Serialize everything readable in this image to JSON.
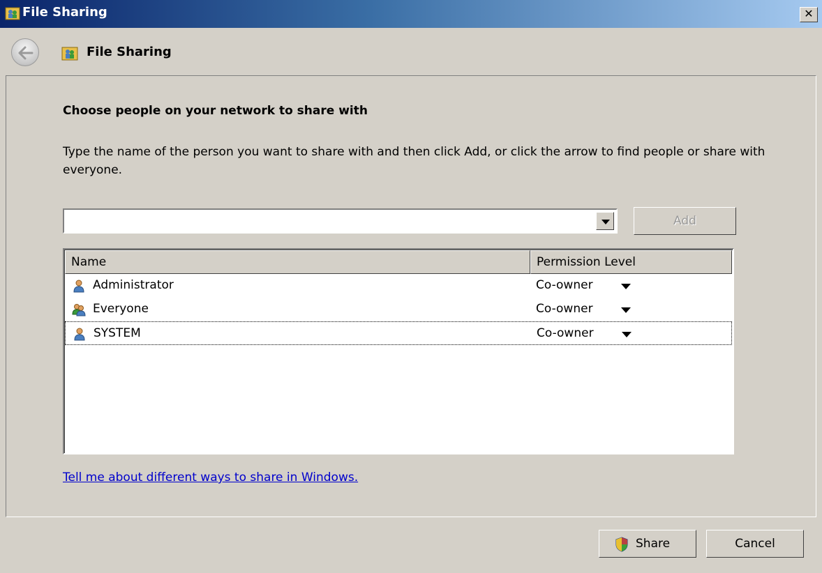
{
  "window": {
    "title": "File Sharing",
    "close_glyph": "✕"
  },
  "nav": {
    "title": "File Sharing",
    "back_icon": "back-arrow-icon"
  },
  "content": {
    "heading": "Choose people on your network to share with",
    "instructions": "Type the name of the person you want to share with and then click Add, or click the arrow to find people or share with everyone.",
    "combo_value": "",
    "add_label": "Add",
    "help_link": "Tell me about different ways to share in Windows."
  },
  "list": {
    "columns": {
      "name": "Name",
      "permission": "Permission Level"
    },
    "rows": [
      {
        "name": "Administrator",
        "permission": "Co-owner",
        "icon": "single-user-icon"
      },
      {
        "name": "Everyone",
        "permission": "Co-owner",
        "icon": "group-users-icon"
      },
      {
        "name": "SYSTEM",
        "permission": "Co-owner",
        "icon": "single-user-icon"
      }
    ]
  },
  "buttons": {
    "share": "Share",
    "cancel": "Cancel"
  },
  "colors": {
    "titlebar_start": "#0a246a",
    "titlebar_end": "#a6caf0",
    "face": "#d4d0c8",
    "link": "#0000cc"
  }
}
